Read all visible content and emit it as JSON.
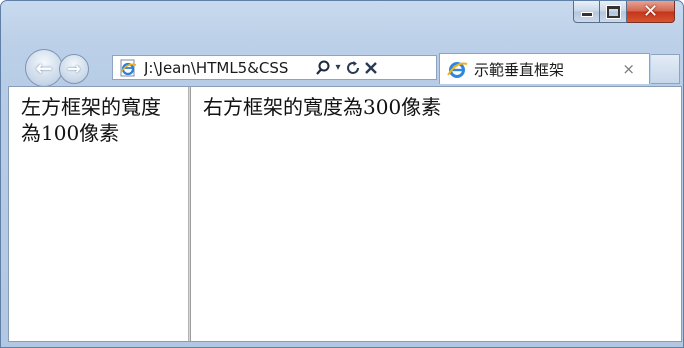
{
  "window": {
    "caption_buttons": {
      "minimize_icon": "minimize-icon",
      "maximize_icon": "maximize-icon",
      "close_icon": "close-icon",
      "close_color": "#c7391f"
    }
  },
  "navigation": {
    "back_icon": "back-arrow-icon",
    "forward_icon": "forward-arrow-icon"
  },
  "address_bar": {
    "url": "J:\\Jean\\HTML5&CSS",
    "site_icon": "ie-page-icon",
    "search_icon": "search-icon",
    "dropdown_icon": "chevron-down-icon",
    "refresh_icon": "refresh-icon",
    "stop_icon": "stop-icon"
  },
  "tab": {
    "title": "示範垂直框架",
    "close_label": "×",
    "icon": "ie-logo-icon"
  },
  "frames": {
    "left": {
      "text": "左方框架的寬度為100像素"
    },
    "right": {
      "text": "右方框架的寬度為300像素"
    }
  },
  "colors": {
    "chrome": "#bcd0e8",
    "content_background": "#ffffff"
  }
}
